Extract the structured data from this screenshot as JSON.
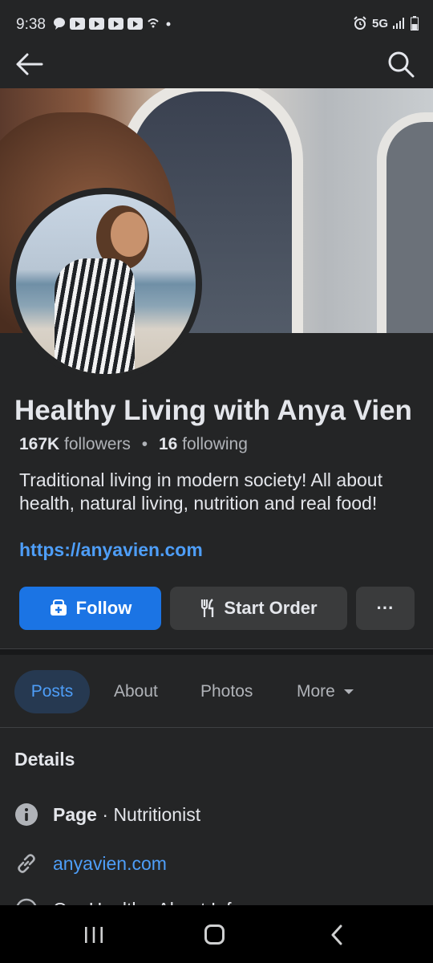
{
  "status_bar": {
    "time": "9:38",
    "network": "5G"
  },
  "nav": {
    "back_icon": "arrow-left-icon",
    "search_icon": "search-icon"
  },
  "profile": {
    "name": "Healthy Living with Anya Vien",
    "followers_count": "167K",
    "followers_label": "followers",
    "separator": "•",
    "following_count": "16",
    "following_label": "following",
    "bio": "Traditional living in modern society! All about health, natural living, nutrition and real food!",
    "website": "https://anyavien.com"
  },
  "actions": {
    "follow_label": "Follow",
    "start_order_label": "Start Order",
    "more_label": "···"
  },
  "tabs": [
    {
      "label": "Posts",
      "active": true
    },
    {
      "label": "About"
    },
    {
      "label": "Photos"
    },
    {
      "label": "More"
    }
  ],
  "details": {
    "title": "Details",
    "page_type_label": "Page",
    "page_type_sep": " · ",
    "page_type_value": "Nutritionist",
    "website_value": "anyavien.com",
    "partial_row": "Our Health · About Info"
  },
  "colors": {
    "background": "#242526",
    "accent": "#1b74e4",
    "link": "#4e9ef8",
    "secondary_button": "#3a3b3c"
  }
}
